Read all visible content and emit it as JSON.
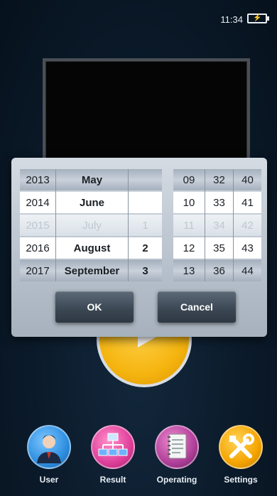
{
  "status": {
    "time": "11:34",
    "battery_icon": "battery-charging-icon"
  },
  "picker": {
    "years": [
      "2013",
      "2014",
      "2015",
      "2016",
      "2017"
    ],
    "months": [
      "May",
      "June",
      "July",
      "August",
      "September"
    ],
    "days": [
      "",
      "",
      "1",
      "2",
      "3"
    ],
    "hours": [
      "09",
      "10",
      "11",
      "12",
      "13"
    ],
    "minutes": [
      "32",
      "33",
      "34",
      "35",
      "36"
    ],
    "seconds": [
      "40",
      "41",
      "42",
      "43",
      "44"
    ],
    "selected": {
      "year": "2015",
      "month": "July",
      "day": "1",
      "hour": "11",
      "minute": "34",
      "second": "42"
    },
    "ok_label": "OK",
    "cancel_label": "Cancel"
  },
  "nav": [
    {
      "label": "User",
      "icon": "user-icon",
      "color": "#2f8fe0"
    },
    {
      "label": "Result",
      "icon": "result-network-icon",
      "color": "#e0409a"
    },
    {
      "label": "Operating",
      "icon": "operating-notebook-icon",
      "color": "#b0409a"
    },
    {
      "label": "Settings",
      "icon": "settings-tools-icon",
      "color": "#f5a500"
    }
  ]
}
